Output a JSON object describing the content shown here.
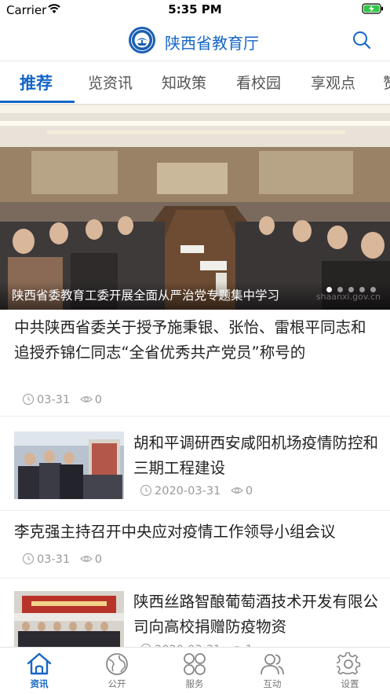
{
  "status_bar": {
    "carrier": "Carrier",
    "time": "5:35 PM"
  },
  "header": {
    "title": "陕西省教育厅"
  },
  "tabs": [
    {
      "label": "推荐"
    },
    {
      "label": "览资讯"
    },
    {
      "label": "知政策"
    },
    {
      "label": "看校园"
    },
    {
      "label": "享观点"
    },
    {
      "label": "赞"
    }
  ],
  "carousel": {
    "caption": "陕西省委教育工委开展全面从严治党专题集中学习",
    "watermark": "shaanxi.gov.cn"
  },
  "news": [
    {
      "title": "中共陕西省委关于授予施秉银、张怡、雷根平同志和追授乔锦仁同志“全省优秀共产党员”称号的",
      "date": "03-31",
      "views": "0"
    },
    {
      "title": "胡和平调研西安咸阳机场疫情防控和三期工程建设",
      "date": "2020-03-31",
      "views": "0"
    },
    {
      "title": "李克强主持召开中央应对疫情工作领导小组会议",
      "date": "03-31",
      "views": "0"
    },
    {
      "title": "陕西丝路智酿葡萄酒技术开发有限公司向高校捐赠防疫物资",
      "date": "2020-03-31",
      "views": "1"
    }
  ],
  "bottom_nav": [
    {
      "label": "资讯",
      "icon": "home-icon"
    },
    {
      "label": "公开",
      "icon": "globe-icon"
    },
    {
      "label": "服务",
      "icon": "grid-icon"
    },
    {
      "label": "互动",
      "icon": "users-icon"
    },
    {
      "label": "设置",
      "icon": "gear-icon"
    }
  ],
  "colors": {
    "accent": "#1566c7",
    "text": "#222222",
    "meta": "#999999"
  }
}
